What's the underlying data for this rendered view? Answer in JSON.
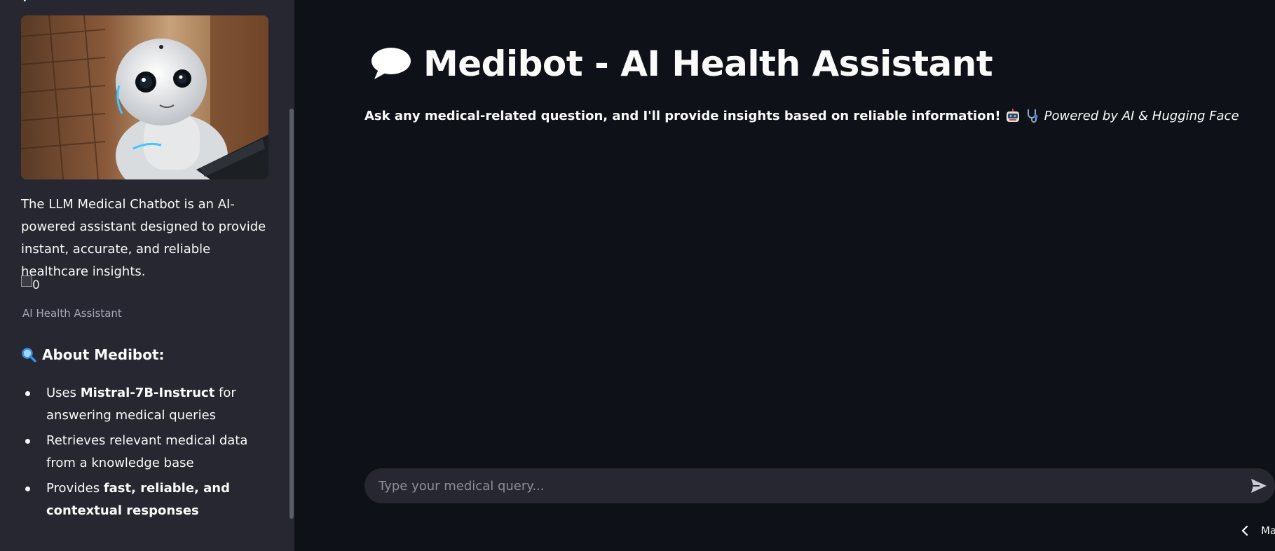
{
  "sidebar": {
    "top_cut_text": "y",
    "description": "The LLM Medical Chatbot is an AI-powered assistant designed to provide instant, accurate, and reliable healthcare insights.",
    "broken_image_alt": "0",
    "caption": "AI Health Assistant",
    "about_heading": "About Medibot:",
    "about_icon": "magnifying-glass-icon",
    "bullets": [
      {
        "pre": "Uses ",
        "bold": "Mistral-7B-Instruct",
        "post": " for answering medical queries"
      },
      {
        "pre": "Retrieves relevant medical data from a knowledge base",
        "bold": "",
        "post": ""
      },
      {
        "pre": "Provides ",
        "bold": "fast, reliable, and contextual responses",
        "post": ""
      }
    ]
  },
  "main": {
    "title_icon": "speech-bubble-icon",
    "title": "Medibot - AI Health Assistant",
    "subtitle_bold": "Ask any medical-related question, and I'll provide insights based on reliable information!",
    "subtitle_emojis": [
      "robot-icon",
      "stethoscope-icon"
    ],
    "subtitle_italic": "Powered by AI & Hugging Face"
  },
  "chat": {
    "placeholder": "Type your medical query...",
    "value": "",
    "send_icon": "send-icon"
  },
  "footer": {
    "nav_icon": "chevron-left-icon",
    "text": "Ma"
  },
  "colors": {
    "main_bg": "#0e1117",
    "sidebar_bg": "#262730",
    "input_bg": "#262730",
    "text": "#fafafa",
    "muted": "#a3a8b8"
  }
}
